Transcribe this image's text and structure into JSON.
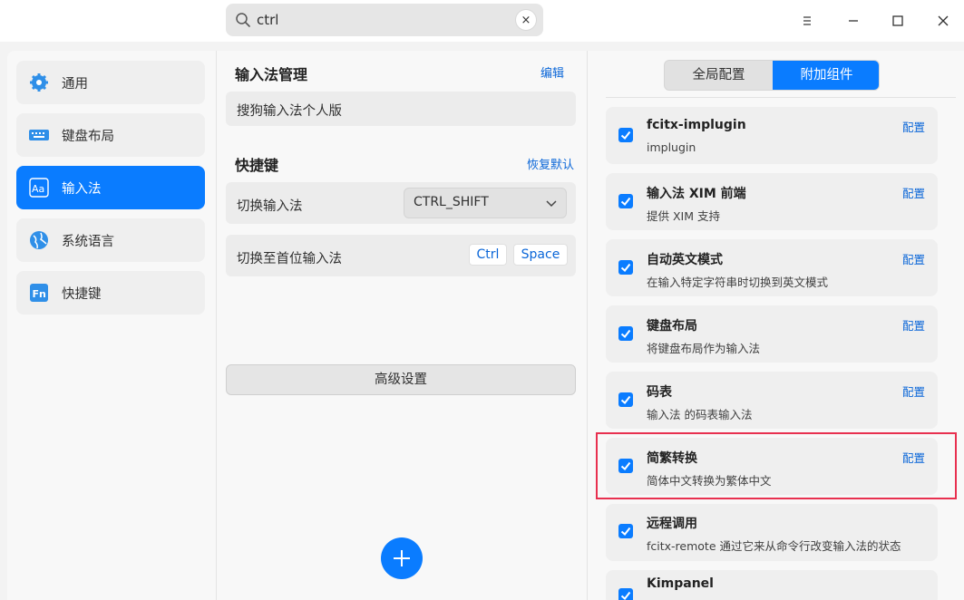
{
  "search": {
    "value": "ctrl",
    "clear_glyph": "×"
  },
  "window_controls": [
    "menu-icon",
    "minimize-icon",
    "maximize-icon",
    "close-icon"
  ],
  "nav": [
    {
      "label": "通用",
      "icon": "gear-icon"
    },
    {
      "label": "键盘布局",
      "icon": "keyboard-icon"
    },
    {
      "label": "输入法",
      "icon": "font-aa-icon",
      "active": true
    },
    {
      "label": "系统语言",
      "icon": "globe-icon"
    },
    {
      "label": "快捷键",
      "icon": "fn-icon"
    }
  ],
  "middle": {
    "im_section_title": "输入法管理",
    "im_edit": "编辑",
    "im_item": "搜狗输入法个人版",
    "shortcut_title": "快捷键",
    "shortcut_reset": "恢复默认",
    "switch_label": "切换输入法",
    "switch_value": "CTRL_SHIFT",
    "first_label": "切换至首位输入法",
    "first_keys": [
      "Ctrl",
      "Space"
    ],
    "advanced": "高级设置"
  },
  "right": {
    "tabs": [
      "全局配置",
      "附加组件"
    ],
    "active_tab": "附加组件",
    "addons": [
      {
        "title": "fcitx-implugin",
        "desc": "implugin",
        "config": "配置",
        "checked": true
      },
      {
        "title": "输入法 XIM 前端",
        "desc": "提供 XIM 支持",
        "config": "配置",
        "checked": true
      },
      {
        "title": "自动英文模式",
        "desc": "在输入特定字符串时切换到英文模式",
        "config": "配置",
        "checked": true
      },
      {
        "title": "键盘布局",
        "desc": "将键盘布局作为输入法",
        "config": "配置",
        "checked": true
      },
      {
        "title": "码表",
        "desc": "输入法 的码表输入法",
        "config": "配置",
        "checked": true
      },
      {
        "title": "简繁转换",
        "desc": "简体中文转换为繁体中文",
        "config": "配置",
        "checked": true,
        "highlighted": true
      },
      {
        "title": "远程调用",
        "desc": "fcitx-remote 通过它来从命令行改变输入法的状态",
        "config": "",
        "checked": true
      },
      {
        "title": "Kimpanel",
        "desc": "",
        "config": "",
        "checked": true
      }
    ]
  },
  "colors": {
    "accent": "#0a7cff",
    "link": "#0a66d8",
    "highlight": "#e8304f"
  }
}
